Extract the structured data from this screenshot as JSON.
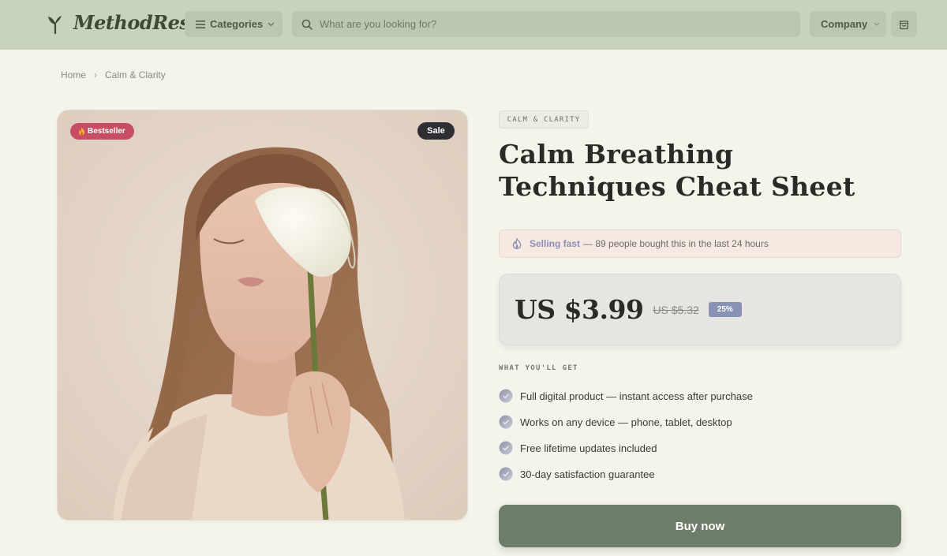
{
  "header": {
    "brand": "MethodRest",
    "categories_label": "Categories",
    "search_placeholder": "What are you looking for?",
    "company_label": "Company"
  },
  "breadcrumb": {
    "home": "Home",
    "separator": "›",
    "current": "Calm & Clarity"
  },
  "image": {
    "badge_bestseller": "Bestseller",
    "badge_sale": "Sale"
  },
  "product": {
    "category_tag": "CALM & CLARITY",
    "title": "Calm Breathing Techniques Cheat Sheet",
    "urgency_strong": "Selling fast",
    "urgency_text": "— 89 people bought this in the last 24 hours",
    "price": "US $3.99",
    "old_price": "US $5.32",
    "discount": "25%",
    "features_heading": "WHAT YOU'LL GET",
    "features": [
      "Full digital product — instant access after purchase",
      "Works on any device — phone, tablet, desktop",
      "Free lifetime updates included",
      "30-day satisfaction guarantee"
    ],
    "buy_label": "Buy now"
  },
  "colors": {
    "header_bg": "#c8d3be",
    "page_bg": "#f5f4ec",
    "buy_button": "#6d7d69",
    "bestseller_badge": "#c84d63",
    "discount_badge": "#8792b4"
  }
}
